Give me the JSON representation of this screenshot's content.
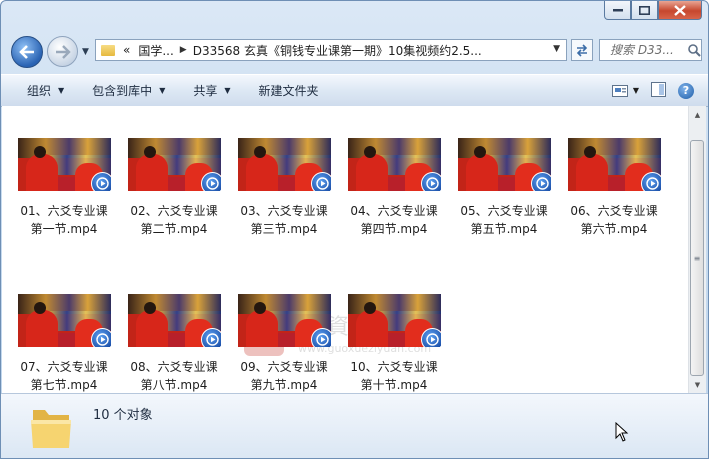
{
  "window": {
    "controls": {
      "minimize": "minimize",
      "maximize": "maximize",
      "close": "close"
    }
  },
  "address_bar": {
    "prefix": "«",
    "crumbs": [
      "国学...",
      "D33568 玄真《铜钱专业课第一期》10集视频约2.5..."
    ],
    "search_placeholder": "搜索 D33..."
  },
  "toolbar": {
    "organize": "组织",
    "include_in_library": "包含到库中",
    "share": "共享",
    "new_folder": "新建文件夹"
  },
  "files": [
    {
      "line1": "01、六爻专业课",
      "line2": "第一节.mp4"
    },
    {
      "line1": "02、六爻专业课",
      "line2": "第二节.mp4"
    },
    {
      "line1": "03、六爻专业课",
      "line2": "第三节.mp4"
    },
    {
      "line1": "04、六爻专业课",
      "line2": "第四节.mp4"
    },
    {
      "line1": "05、六爻专业课",
      "line2": "第五节.mp4"
    },
    {
      "line1": "06、六爻专业课",
      "line2": "第六节.mp4"
    },
    {
      "line1": "07、六爻专业课",
      "line2": "第七节.mp4"
    },
    {
      "line1": "08、六爻专业课",
      "line2": "第八节.mp4"
    },
    {
      "line1": "09、六爻专业课",
      "line2": "第九节.mp4"
    },
    {
      "line1": "10、六爻专业课",
      "line2": "第十节.mp4"
    }
  ],
  "watermark": {
    "logo_char": "國",
    "text": "學 資 源 網",
    "url": "www.guoxueziyuan.com"
  },
  "details": {
    "count_text": "10 个对象"
  },
  "colors": {
    "accent": "#2a63b3",
    "toolbar": "#dde8f4",
    "close": "#c6472e"
  }
}
